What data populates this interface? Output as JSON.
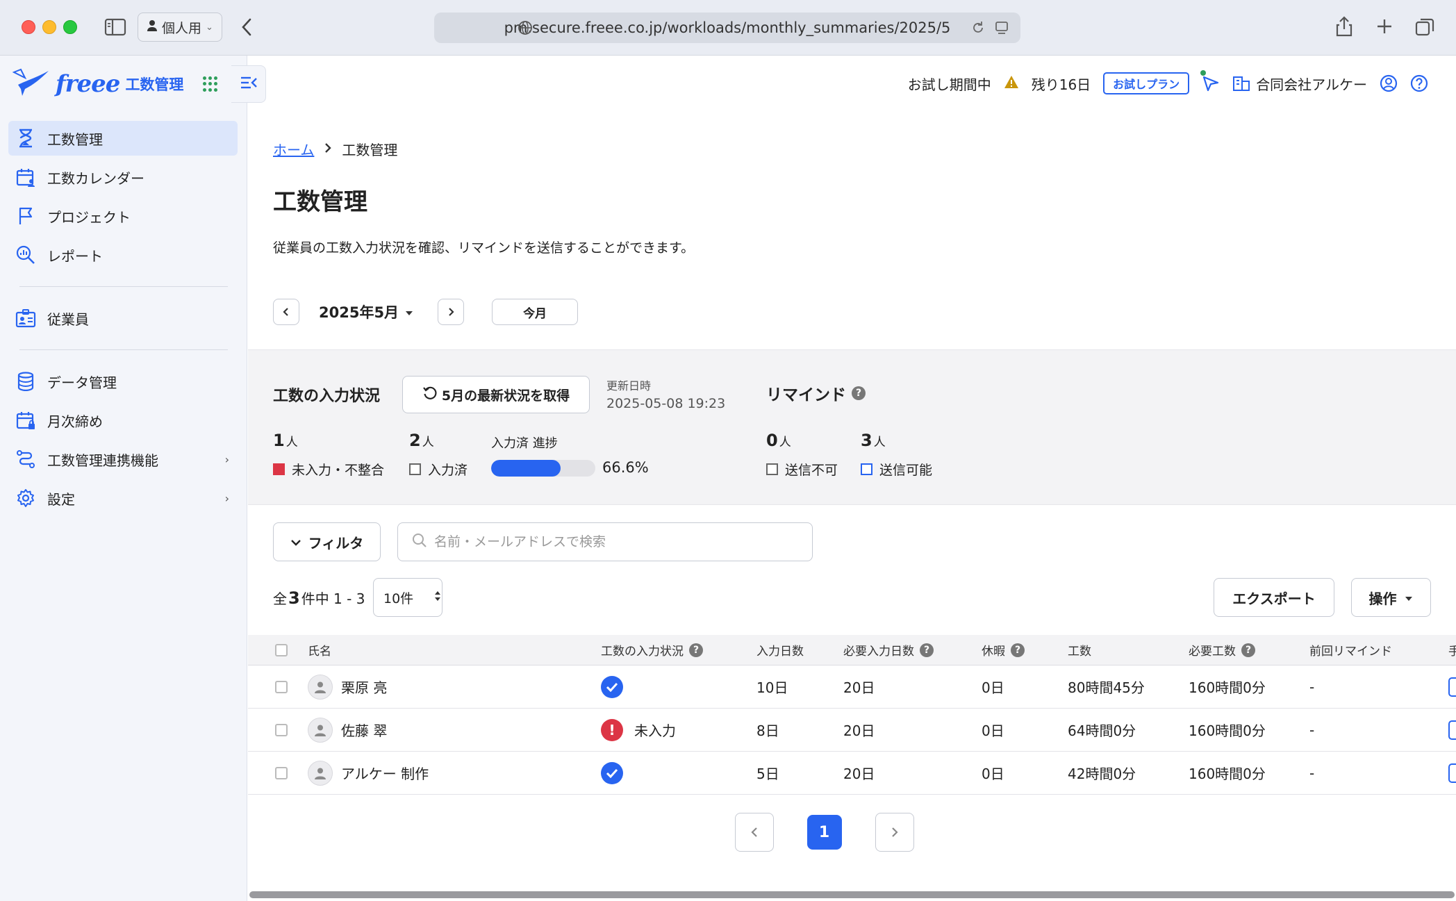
{
  "browser": {
    "profile_label": "個人用",
    "url": "pm.secure.freee.co.jp/workloads/monthly_summaries/2025/5"
  },
  "sidebar": {
    "logo_word": "freee",
    "logo_sub": "工数管理",
    "items": [
      {
        "label": "工数管理",
        "icon": "hourglass-icon",
        "active": true
      },
      {
        "label": "工数カレンダー",
        "icon": "calendar-user-icon"
      },
      {
        "label": "プロジェクト",
        "icon": "flag-icon"
      },
      {
        "label": "レポート",
        "icon": "report-search-icon"
      },
      {
        "label": "従業員",
        "icon": "id-card-icon"
      },
      {
        "label": "データ管理",
        "icon": "database-icon"
      },
      {
        "label": "月次締め",
        "icon": "calendar-lock-icon"
      },
      {
        "label": "工数管理連携機能",
        "icon": "integration-icon",
        "has_submenu": true
      },
      {
        "label": "設定",
        "icon": "gear-icon",
        "has_submenu": true
      }
    ]
  },
  "topbar": {
    "trial_text": "お試し期間中",
    "remaining": "残り16日",
    "plan_badge": "お試しプラン",
    "company": "合同会社アルケー"
  },
  "breadcrumb": {
    "home": "ホーム",
    "current": "工数管理"
  },
  "page": {
    "title": "工数管理",
    "description": "従業員の工数入力状況を確認、リマインドを送信することができます。"
  },
  "month_nav": {
    "month": "2025年5月",
    "today_label": "今月"
  },
  "status": {
    "title": "工数の入力状況",
    "refresh_label": "5月の最新状況を取得",
    "updated_label": "更新日時",
    "updated_value": "2025-05-08 19:23",
    "missing_count": "1",
    "missing_label": "未入力・不整合",
    "done_count": "2",
    "done_label": "入力済",
    "unit": "人",
    "progress_label": "入力済 進捗",
    "progress_value": "66.6%",
    "progress_fraction": 0.666
  },
  "remind": {
    "title": "リマインド",
    "unsendable_count": "0",
    "unsendable_label": "送信不可",
    "sendable_count": "3",
    "sendable_label": "送信可能"
  },
  "toolbar": {
    "filter_label": "フィルタ",
    "search_placeholder": "名前・メールアドレスで検索",
    "total_prefix": "全",
    "total_count": "3",
    "total_suffix": "件中 1 - 3",
    "per_page": "10件",
    "export_label": "エクスポート",
    "ops_label": "操作"
  },
  "table": {
    "headers": [
      "氏名",
      "工数の入力状況",
      "入力日数",
      "必要入力日数",
      "休暇",
      "工数",
      "必要工数",
      "前回リマインド",
      "手"
    ],
    "rows": [
      {
        "name": "栗原 亮",
        "status": "ok",
        "status_text": "",
        "input_days": "10日",
        "required_days": "20日",
        "leave": "0日",
        "hours": "80時間45分",
        "required_hours": "160時間0分",
        "last_remind": "-"
      },
      {
        "name": "佐藤 翠",
        "status": "missing",
        "status_text": "未入力",
        "input_days": "8日",
        "required_days": "20日",
        "leave": "0日",
        "hours": "64時間0分",
        "required_hours": "160時間0分",
        "last_remind": "-"
      },
      {
        "name": "アルケー 制作",
        "status": "ok",
        "status_text": "",
        "input_days": "5日",
        "required_days": "20日",
        "leave": "0日",
        "hours": "42時間0分",
        "required_hours": "160時間0分",
        "last_remind": "-"
      }
    ]
  },
  "pagination": {
    "current": "1"
  },
  "colors": {
    "accent": "#2864f0",
    "danger": "#dc3545"
  }
}
